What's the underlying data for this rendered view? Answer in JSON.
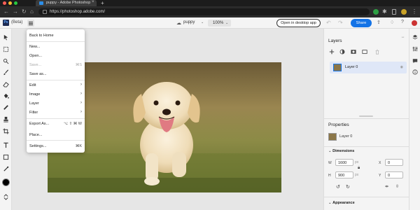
{
  "browser": {
    "tab_title": "puppy - Adobe Photoshop",
    "tab_close": "×",
    "new_tab": "+",
    "url": "https://photoshop.adobe.com/",
    "traffic_lights": [
      "#ff5f57",
      "#febc2e",
      "#28c840"
    ],
    "nav": {
      "back": "←",
      "forward": "→",
      "reload": "↻",
      "home": "⌂"
    },
    "extension_icons": [
      "green-extension-icon",
      "puzzle-icon",
      "bookmark-icon",
      "profile-icon",
      "more-icon"
    ]
  },
  "app": {
    "logo": "Ps",
    "beta_label": "(Beta)",
    "doc_name": "puppy",
    "zoom": "100%",
    "open_desktop_label": "Open in desktop app",
    "share_label": "Share",
    "undo": "↶",
    "redo": "↷",
    "accent": "#1473e6"
  },
  "menu": {
    "items": [
      {
        "label": "Back to Home"
      },
      {
        "label": "New..."
      },
      {
        "label": "Open..."
      },
      {
        "label": "Save...",
        "shortcut": "⌘S",
        "disabled": true
      },
      {
        "label": "Save as..."
      },
      {
        "label": "Edit",
        "arrow": "›"
      },
      {
        "label": "Image",
        "arrow": "›"
      },
      {
        "label": "Layer",
        "arrow": "›"
      },
      {
        "label": "Filter",
        "arrow": "›"
      },
      {
        "label": "Export As...",
        "shortcut": "⌥ ⇧ ⌘ W"
      },
      {
        "label": "Place..."
      },
      {
        "label": "Settings...",
        "shortcut": "⌘K"
      }
    ]
  },
  "tools": [
    "move-tool-icon",
    "marquee-tool-icon",
    "quick-select-icon",
    "brush-icon",
    "eraser-icon",
    "fill-bucket-icon",
    "healing-brush-icon",
    "clone-stamp-icon",
    "crop-icon",
    "type-tool-icon",
    "shape-tool-icon",
    "eyedropper-icon",
    "foreground-color-swatch",
    "swap-colors-icon"
  ],
  "layers_panel": {
    "title": "Layers",
    "layer_name": "Layer 0"
  },
  "properties_panel": {
    "title": "Properties",
    "layer_name": "Layer 0",
    "dimensions_label": "Dimensions",
    "w_label": "W",
    "h_label": "H",
    "x_label": "X",
    "y_label": "Y",
    "w_value": "1600",
    "h_value": "900",
    "x_value": "0",
    "y_value": "0",
    "appearance_label": "Appearance",
    "px_unit": "px"
  },
  "side_icons": [
    "layers-stack-icon",
    "adjust-icon",
    "comment-icon",
    "info-icon"
  ]
}
